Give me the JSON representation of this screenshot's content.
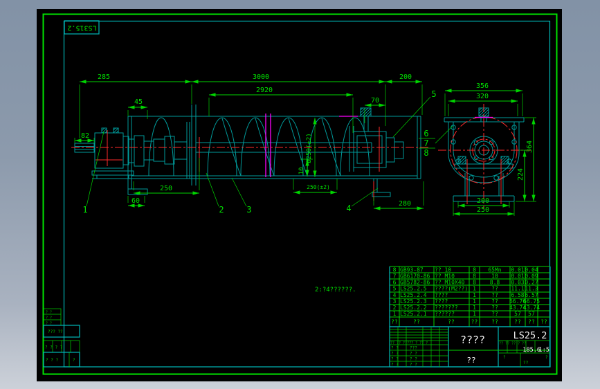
{
  "corner_label": "LS315.2",
  "note_text": "2:?4??????.",
  "colors": {
    "canvas": "#000000",
    "frame_green": "#00e400",
    "drawing_teal": "#009a9a",
    "dimension_green": "#00d400",
    "centerline_red": "#ff2a2a",
    "break_magenta": "#ff00ff",
    "text_white": "#f2f2f2",
    "desktop_gray": "#8c9aac"
  },
  "side_view_dims": {
    "overall_left": "285",
    "overall_length": "3000",
    "inner_length": "2920",
    "right_extension": "200",
    "inlet_offset": "45",
    "bolt_spacing": "70",
    "shaft_stub": "82",
    "hanger_offset": "250",
    "foot_width": "60",
    "outlet_offset": "280",
    "flight_thickness": "10",
    "pitch": "250(±2)",
    "screw_diameter": "Ø250(±2)"
  },
  "end_view_dims": {
    "flange_width": "356",
    "bolt_width": "320",
    "total_height": "364",
    "lower_height": "224",
    "feet_inner": "200",
    "feet_outer": "250"
  },
  "balloons": {
    "b1": "1",
    "b2": "2",
    "b3": "3",
    "b4": "4",
    "b5": "5",
    "b6": "6",
    "b7": "7",
    "b8": "8"
  },
  "bom": {
    "headers": [
      "??",
      "??",
      "??",
      "??",
      "??",
      "??",
      "??",
      "??"
    ],
    "rows": [
      {
        "no": "8",
        "code": "GB93-87",
        "name": "?? 10",
        "qty": "8",
        "mat": "65Mn",
        "unit": "0.01",
        "total": "0.04",
        "rm": ""
      },
      {
        "no": "7",
        "code": "GB6170-86",
        "name": "?? M10",
        "qty": "8",
        "mat": "10",
        "unit": "0.01",
        "total": "0.09",
        "rm": ""
      },
      {
        "no": "6",
        "code": "GB5782-86",
        "name": "?? M10X40",
        "qty": "8",
        "mat": "8.8",
        "unit": "0.03",
        "total": "0.27",
        "rm": ""
      },
      {
        "no": "5",
        "code": "LS25.2.5",
        "name": "????(M2??)",
        "qty": "1",
        "mat": "??",
        "unit": "11.1",
        "total": "11.3",
        "rm": ""
      },
      {
        "no": "4",
        "code": "LS25.2.4",
        "name": "????",
        "qty": "1",
        "mat": "??",
        "unit": "6.58",
        "total": "6.57",
        "rm": ""
      },
      {
        "no": "3",
        "code": "LS25.2.3",
        "name": "????",
        "qty": "1",
        "mat": "??",
        "unit": "66.76",
        "total": "66.75",
        "rm": ""
      },
      {
        "no": "2",
        "code": "LS25.2.2",
        "name": "???????",
        "qty": "1",
        "mat": "??",
        "unit": "43.74",
        "total": "43.74",
        "rm": ""
      },
      {
        "no": "1",
        "code": "LS25.2.1",
        "name": "??????",
        "qty": "1",
        "mat": "??",
        "unit": "57",
        "total": "57",
        "rm": ""
      }
    ]
  },
  "title_block": {
    "drawing_no": "LS25.2",
    "title": "????",
    "subtitle": "??",
    "weight": "185.6",
    "scale": "1:5",
    "meta_header": "?? ?? ?? ? ??",
    "rev_header": "?? ?? ????? ? ?? ?",
    "rev_rows": [
      [
        "? ?",
        "???"
      ],
      [
        "? ?",
        "? ?"
      ],
      [
        "? ?",
        "? ?"
      ],
      [
        "? ?",
        "? ?"
      ]
    ],
    "marks": [
      "?",
      "??",
      "?"
    ]
  },
  "left_strip": {
    "box1_rows": [
      "? ?",
      "? ?",
      "? ?"
    ],
    "box2": "??? ??",
    "row4": "? ? ? ?",
    "box3": "? ? ?",
    "box3b": "?"
  }
}
